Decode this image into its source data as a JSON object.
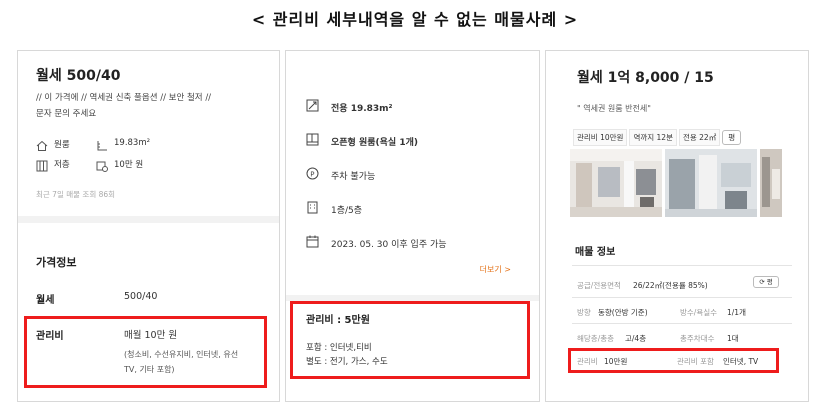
{
  "page": {
    "title": "< 관리비 세부내역을 알 수 없는 매물사례 >"
  },
  "listing1": {
    "title": "월세 500/40",
    "desc_line1": "// 이 가격에 // 역세권 신축 풀옵션 // 보안 철저 //",
    "desc_line2": "문자 문의 주세요",
    "features": [
      {
        "icon": "house-icon",
        "label": "원룸"
      },
      {
        "icon": "ruler-icon",
        "label": "19.83m²"
      },
      {
        "icon": "stairs-icon",
        "label": "저층"
      },
      {
        "icon": "money-icon",
        "label": "10만 원"
      }
    ],
    "views": "최근 7일 매물 조회 86회",
    "section_title": "가격정보",
    "rent_label": "월세",
    "rent_value": "500/40",
    "fee_label": "관리비",
    "fee_value": "매월 10만 원",
    "fee_detail_1": "(청소비, 수선유지비, 인터넷, 유선",
    "fee_detail_2": "TV, 기타 포함)"
  },
  "listing2": {
    "items": [
      {
        "icon": "area-icon",
        "text": "전용 19.83m²"
      },
      {
        "icon": "layout-icon",
        "text": "오픈형 원룸(욕실 1개)"
      },
      {
        "icon": "parking-icon",
        "text": "주차 불가능"
      },
      {
        "icon": "building-icon",
        "text": "1층/5층"
      },
      {
        "icon": "calendar-icon",
        "text": "2023. 05. 30 이후 입주 가능"
      }
    ],
    "more_label": "더보기  >",
    "fee_title": "관리비 : 5만원",
    "included": "포함 : 인터넷,티비",
    "separate": "별도 : 전기, 가스, 수도"
  },
  "listing3": {
    "title": "월세 1억 8,000 / 15",
    "quote": "\"   역세권 원룸 반전세\"",
    "chips": [
      "관리비 10만원",
      "역까지 12분",
      "전용 22㎡"
    ],
    "unit_toggle": "평",
    "section_title": "매물 정보",
    "rows": [
      {
        "k1": "공급/전용면적",
        "v1": "26/22㎡(전용률 85%)",
        "k2": "",
        "v2": ""
      },
      {
        "k1": "방향",
        "v1": "동향(안방 기준)",
        "k2": "방수/욕실수",
        "v2": "1/1개"
      },
      {
        "k1": "해당층/총층",
        "v1": "고/4층",
        "k2": "총주차대수",
        "v2": "1대"
      },
      {
        "k1": "관리비",
        "v1": "10만원",
        "k2": "관리비 포함",
        "v2": "인터넷, TV"
      }
    ],
    "area_toggle": "⟳ 평"
  },
  "colors": {
    "highlight": "#ee1c1c",
    "accent_orange": "#e4731a",
    "panel_border": "#d8d8d8"
  }
}
